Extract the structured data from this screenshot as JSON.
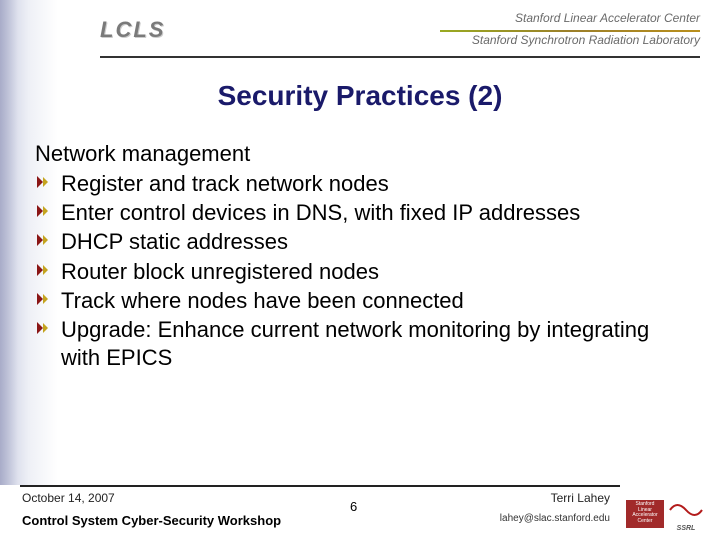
{
  "header": {
    "logo_text": "LCLS",
    "org1": "Stanford Linear Accelerator Center",
    "org2": "Stanford Synchrotron Radiation Laboratory"
  },
  "title": "Security Practices (2)",
  "content": {
    "heading": "Network management",
    "bullets": [
      "Register and track network nodes",
      "Enter control devices in DNS, with fixed IP addresses",
      "DHCP static addresses",
      "Router block unregistered nodes",
      "Track where nodes have been connected",
      "Upgrade: Enhance current network monitoring by integrating with EPICS"
    ]
  },
  "footer": {
    "date": "October 14, 2007",
    "workshop": "Control System Cyber-Security Workshop",
    "page": "6",
    "author": "Terri Lahey",
    "email": "lahey@slac.stanford.edu",
    "slac_label": "Stanford Linear Accelerator Center",
    "ssrl_label": "SSRL"
  }
}
